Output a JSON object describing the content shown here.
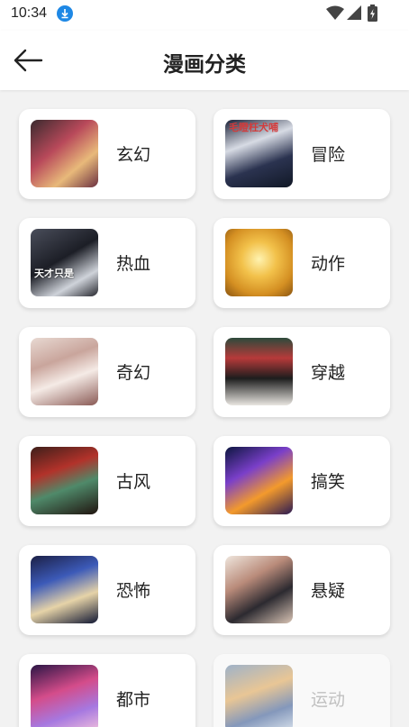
{
  "status_bar": {
    "time": "10:34"
  },
  "header": {
    "title": "漫画分类",
    "back_icon": "arrow-left-icon"
  },
  "colors": {
    "background": "#f2f2f2",
    "card": "#ffffff",
    "text": "#222222",
    "download_badge": "#1e88e5"
  },
  "categories": [
    {
      "label": "玄幻"
    },
    {
      "label": "冒险",
      "cover_text": "毛瞪枉犬哺"
    },
    {
      "label": "热血",
      "cover_text": "天才只是"
    },
    {
      "label": "动作"
    },
    {
      "label": "奇幻"
    },
    {
      "label": "穿越"
    },
    {
      "label": "古风"
    },
    {
      "label": "搞笑"
    },
    {
      "label": "恐怖"
    },
    {
      "label": "悬疑"
    },
    {
      "label": "都市"
    },
    {
      "label": "运动"
    }
  ]
}
